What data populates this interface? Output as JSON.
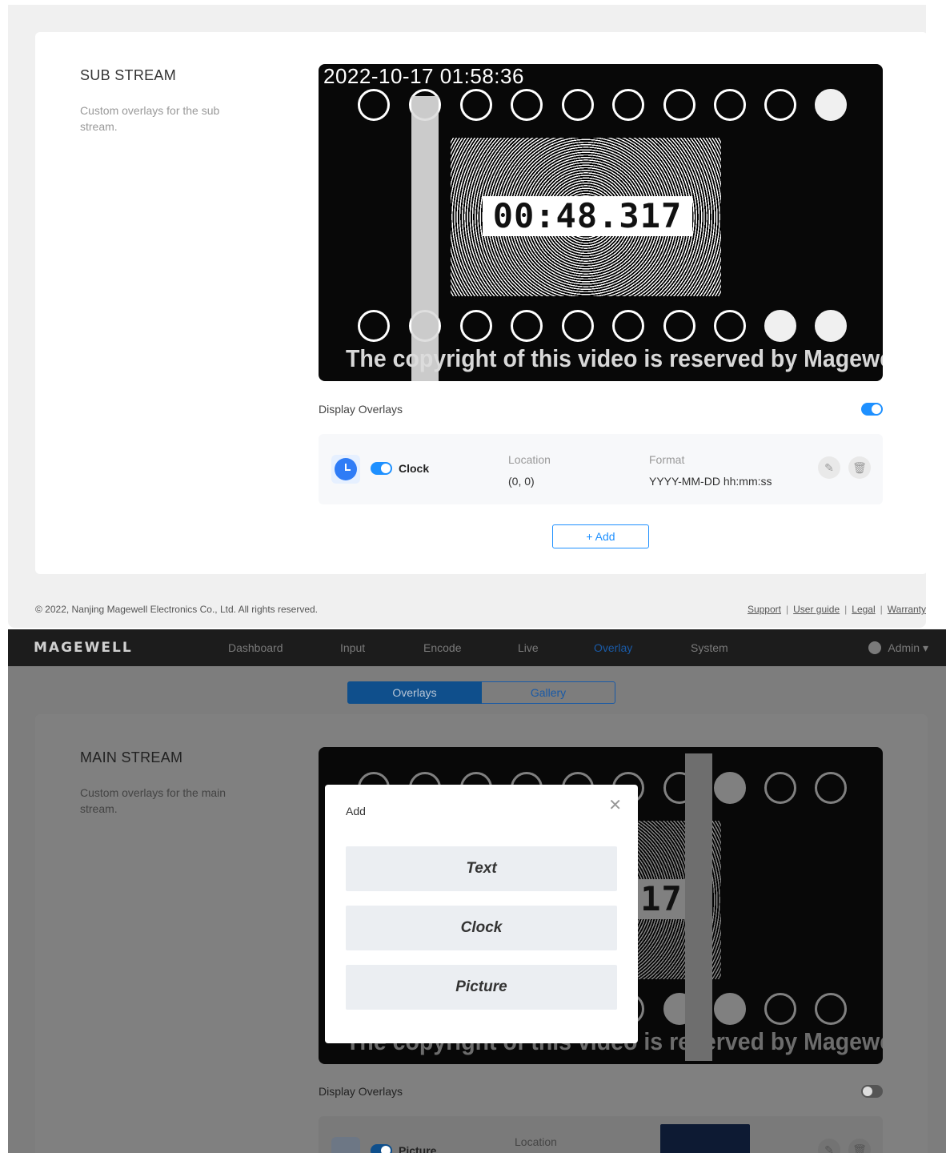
{
  "sub_stream": {
    "title": "SUB STREAM",
    "description": "Custom overlays for the sub stream.",
    "preview": {
      "timestamp": "2022-10-17 01:58:36",
      "timer": "00:48.317",
      "copyright": "The copyright of this video is reserved by Magewell"
    },
    "display_overlays_label": "Display Overlays",
    "display_overlays_on": true,
    "overlays": [
      {
        "name": "Clock",
        "enabled": true,
        "icon": "clock-icon",
        "location_label": "Location",
        "location": "(0, 0)",
        "format_label": "Format",
        "format": "YYYY-MM-DD hh:mm:ss"
      }
    ],
    "add_label": "+ Add"
  },
  "footer": {
    "copyright": "© 2022, Nanjing Magewell Electronics Co., Ltd. All rights reserved.",
    "links": [
      "Support",
      "User guide",
      "Legal",
      "Warranty"
    ]
  },
  "navbar": {
    "logo": "MAGEWELL",
    "items": [
      "Dashboard",
      "Input",
      "Encode",
      "Live",
      "Overlay",
      "System"
    ],
    "active": "Overlay",
    "user": "Admin"
  },
  "tabs": {
    "items": [
      "Overlays",
      "Gallery"
    ],
    "active": "Overlays"
  },
  "main_stream": {
    "title": "MAIN STREAM",
    "description": "Custom overlays for the main stream.",
    "preview": {
      "timer_fragment": "17",
      "copyright": "The copyright of this video is reserved by Magewell"
    },
    "display_overlays_label": "Display Overlays",
    "display_overlays_on": false,
    "overlays": [
      {
        "name": "Picture",
        "enabled": true,
        "icon": "picture-icon",
        "location_label": "Location"
      }
    ]
  },
  "add_modal": {
    "title": "Add",
    "close_icon": "close-icon",
    "options": [
      "Text",
      "Clock",
      "Picture"
    ]
  },
  "colors": {
    "accent": "#1e90ff",
    "navbar_bg": "#1c1c1c",
    "overlay_dim": "#7d7d7d"
  }
}
